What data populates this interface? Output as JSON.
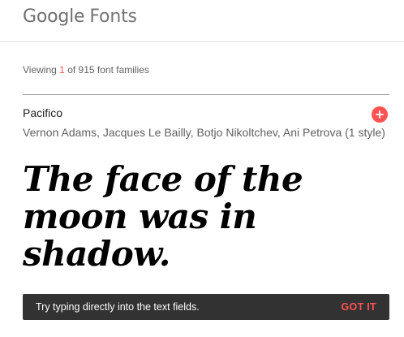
{
  "header": {
    "brand": "Google",
    "product": "Fonts"
  },
  "results": {
    "prefix": "Viewing",
    "shown": "1",
    "suffix": "of 915 font families"
  },
  "font_card": {
    "family": "Pacifico",
    "designers": "Vernon Adams, Jacques Le Bailly, Botjo Nikoltchev, Ani Petrova (1 style)",
    "sample_text": "The face of the moon was in shadow.",
    "add_icon": "plus-icon",
    "accent_color": "#ff5252"
  },
  "toast": {
    "message": "Try typing directly into the text fields.",
    "action": "GOT IT"
  }
}
